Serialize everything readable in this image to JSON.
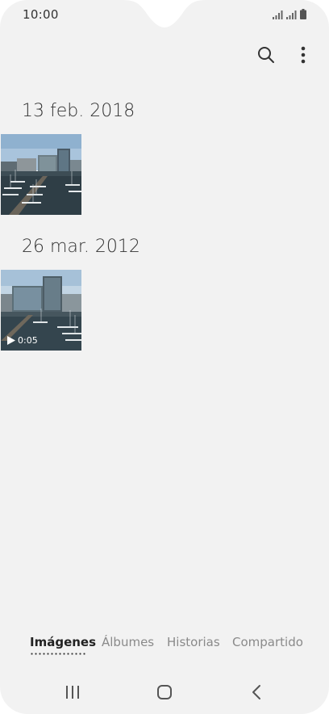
{
  "status_bar": {
    "time": "10:00",
    "icons": [
      "signal-icon",
      "signal-icon",
      "battery-icon"
    ]
  },
  "toolbar": {
    "icons": [
      "search-icon",
      "more-vert-icon"
    ]
  },
  "groups": [
    {
      "date": "13 feb. 2018",
      "items": [
        {
          "kind": "image",
          "icon": "harbor-photo"
        }
      ]
    },
    {
      "date": "26 mar. 2012",
      "items": [
        {
          "kind": "video",
          "duration": "0:05",
          "icon": "play-icon"
        }
      ]
    }
  ],
  "tabs": [
    {
      "label": "Imágenes",
      "active": true
    },
    {
      "label": "Álbumes",
      "active": false
    },
    {
      "label": "Historias",
      "active": false
    },
    {
      "label": "Compartido",
      "active": false
    }
  ],
  "navbar": {
    "icons": [
      "recents-icon",
      "home-icon",
      "back-icon"
    ]
  },
  "colors": {
    "background": "#f2f2f2",
    "text": "#333333",
    "inactive_tab": "#8a8a8a"
  }
}
